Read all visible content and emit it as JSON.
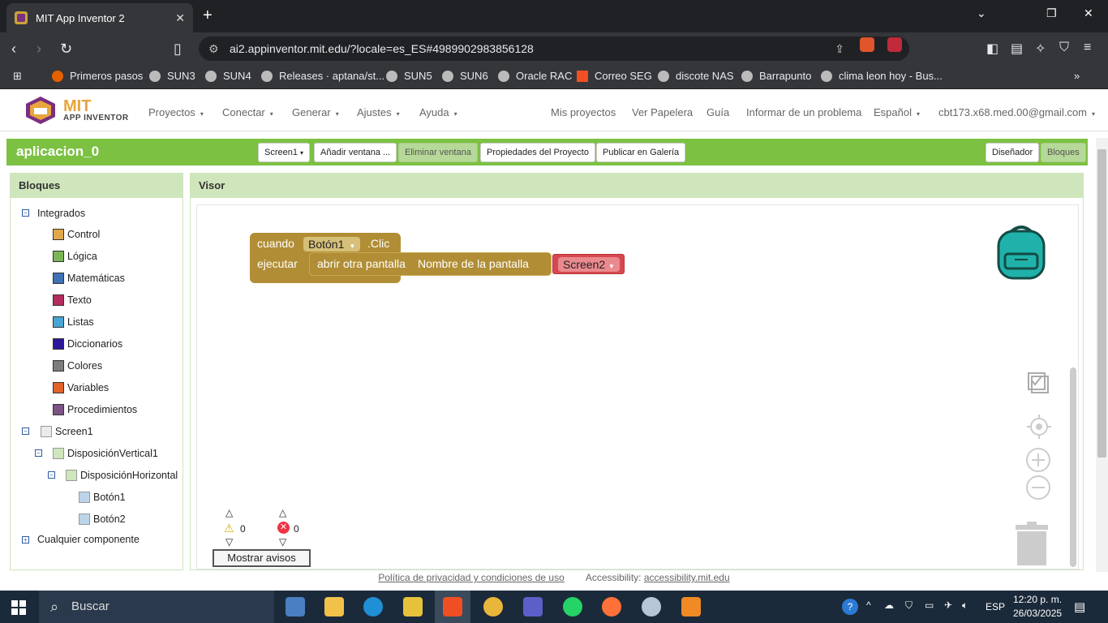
{
  "browser": {
    "tab_title": "MIT App Inventor 2",
    "url": "ai2.appinventor.mit.edu/?locale=es_ES#4989902983856128",
    "bookmarks": [
      "Primeros pasos",
      "SUN3",
      "SUN4",
      "Releases · aptana/st...",
      "SUN5",
      "SUN6",
      "Oracle RAC",
      "Correo SEG",
      "discote NAS",
      "Barrapunto",
      "clima leon hoy - Bus..."
    ],
    "badge_brave": "1",
    "badge_alert": "1"
  },
  "app": {
    "logo_mit": "MIT",
    "logo_sub": "APP INVENTOR",
    "menus": [
      "Proyectos",
      "Conectar",
      "Generar",
      "Ajustes",
      "Ayuda"
    ],
    "right_links": [
      "Mis proyectos",
      "Ver Papelera",
      "Guía",
      "Informar de un problema"
    ],
    "language": "Español",
    "account": "cbt173.x68.med.00@gmail.com"
  },
  "toolbar": {
    "project_name": "aplicacion_0",
    "screen_select": "Screen1",
    "add_window": "Añadir ventana ...",
    "remove_window": "Eliminar ventana",
    "project_props": "Propiedades del Proyecto",
    "publish": "Publicar en Galería",
    "designer": "Diseñador",
    "blocks": "Bloques"
  },
  "blocks_panel": {
    "title": "Bloques",
    "builtin": "Integrados",
    "categories": [
      {
        "label": "Control",
        "color": "#e1a84a"
      },
      {
        "label": "Lógica",
        "color": "#7ab656"
      },
      {
        "label": "Matemáticas",
        "color": "#3f71b5"
      },
      {
        "label": "Texto",
        "color": "#b32d5e"
      },
      {
        "label": "Listas",
        "color": "#49a6d4"
      },
      {
        "label": "Diccionarios",
        "color": "#2d1799"
      },
      {
        "label": "Colores",
        "color": "#7d7d7d"
      },
      {
        "label": "Variables",
        "color": "#e2632a"
      },
      {
        "label": "Procedimientos",
        "color": "#7c5385"
      }
    ],
    "screen": "Screen1",
    "vertical": "DisposiciónVertical1",
    "horizontal": "DisposiciónHorizontal",
    "button1": "Botón1",
    "button2": "Botón2",
    "any_component": "Cualquier componente"
  },
  "viewer": {
    "title": "Visor",
    "event_when": "cuando",
    "event_component": "Botón1",
    "event_name": ".Clic",
    "do": "ejecutar",
    "open_screen": "abrir otra pantalla",
    "screen_name_label": "Nombre de la pantalla",
    "screen_value": "Screen2",
    "warnings_count": "0",
    "errors_count": "0",
    "show_warnings": "Mostrar avisos"
  },
  "footer": {
    "privacy": "Política de privacidad y condiciones de uso",
    "accessibility_label": "Accessibility:",
    "accessibility_link": "accessibility.mit.edu"
  },
  "taskbar": {
    "search": "Buscar",
    "lang": "ESP",
    "time": "12:20 p. m.",
    "date": "26/03/2025"
  }
}
